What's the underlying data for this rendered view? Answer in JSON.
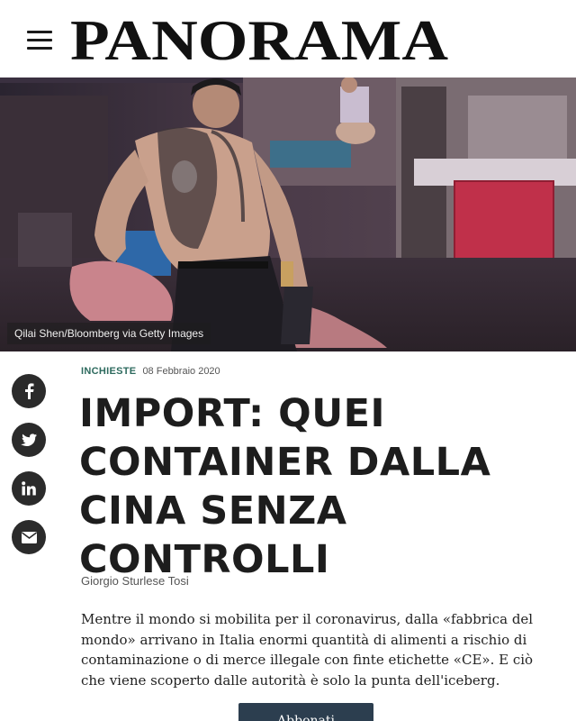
{
  "header": {
    "logo_text": "PANORAMA"
  },
  "hero": {
    "photo_credit": "Qilai Shen/Bloomberg via Getty Images"
  },
  "share": {
    "items": [
      "facebook-icon",
      "twitter-icon",
      "linkedin-icon",
      "email-icon"
    ]
  },
  "article": {
    "category": "INCHIESTE",
    "date": "08 Febbraio 2020",
    "title": "IMPORT: QUEI CONTAINER DALLA CINA SENZA CONTROLLI",
    "author": "Giorgio Sturlese Tosi",
    "lead": "Mentre il mondo si mobilita per il coronavirus, dalla «fabbrica del mondo» arrivano in Italia enormi quantità di alimenti a rischio di contaminazione o di merce illegale con finte etichette «CE». E ciò che viene scoperto dalle autorità è solo la punta dell'iceberg."
  },
  "cta": {
    "subscribe_label": "Abbonati"
  },
  "colors": {
    "category": "#2d6a5e",
    "subscribe_bg": "#2c3e4f",
    "share_bg": "#2b2b2b"
  }
}
